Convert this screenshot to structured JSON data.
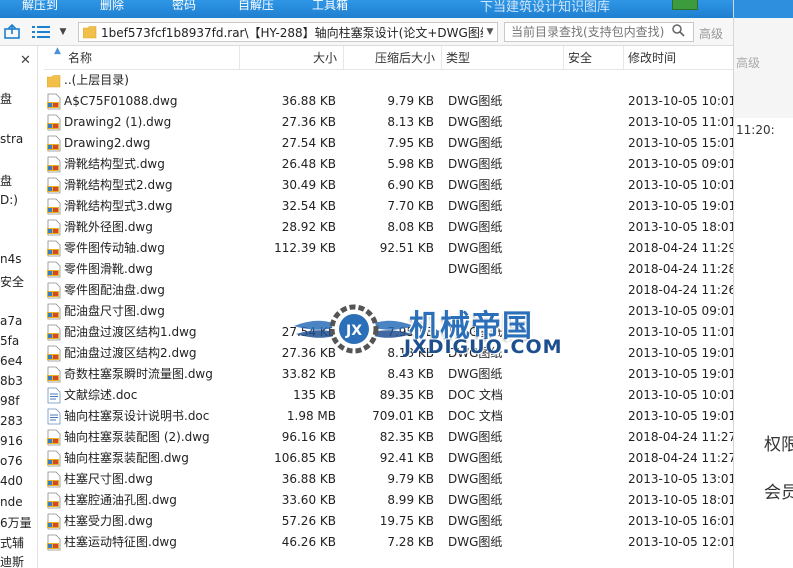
{
  "toolbar": {
    "extract_label": "解压到",
    "delete_label": "删除",
    "password_label": "密码",
    "selfextract_label": "自解压",
    "tools_label": "工具箱",
    "promo_text": "下当建筑设计知识图库"
  },
  "address": {
    "path": "1bef573fcf1b8937fd.rar\\【HY-288】轴向柱塞泵设计(论文+DWG图纸)",
    "search_placeholder": "当前目录查找(支持包内查找)",
    "advanced_label": "高级"
  },
  "left_pane": {
    "lines": [
      "盘",
      "stra",
      "盘",
      "D:)",
      "n4s",
      "安全",
      "a7a",
      "5fa",
      "6e4",
      "8b3",
      "98f",
      "283",
      "916",
      "o76",
      "4d0",
      "nde",
      "6万量",
      "式辅",
      "迪斯"
    ]
  },
  "columns": {
    "name": "名称",
    "size": "大小",
    "compressed": "压缩后大小",
    "type": "类型",
    "security": "安全",
    "modified": "修改时间"
  },
  "parent_row": {
    "name": "..(上层目录)"
  },
  "files": [
    {
      "name": "A$C75F01088.dwg",
      "size": "36.88 KB",
      "compressed": "9.79 KB",
      "type": "DWG图纸",
      "modified": "2013-10-05 10:01:",
      "icon": "dwg"
    },
    {
      "name": "Drawing2 (1).dwg",
      "size": "27.36 KB",
      "compressed": "8.13 KB",
      "type": "DWG图纸",
      "modified": "2013-10-05 11:01:",
      "icon": "dwg"
    },
    {
      "name": "Drawing2.dwg",
      "size": "27.54 KB",
      "compressed": "7.95 KB",
      "type": "DWG图纸",
      "modified": "2013-10-05 15:01:",
      "icon": "dwg"
    },
    {
      "name": "滑靴结构型式.dwg",
      "size": "26.48 KB",
      "compressed": "5.98 KB",
      "type": "DWG图纸",
      "modified": "2013-10-05 09:01:",
      "icon": "dwg"
    },
    {
      "name": "滑靴结构型式2.dwg",
      "size": "30.49 KB",
      "compressed": "6.90 KB",
      "type": "DWG图纸",
      "modified": "2013-10-05 10:01:",
      "icon": "dwg"
    },
    {
      "name": "滑靴结构型式3.dwg",
      "size": "32.54 KB",
      "compressed": "7.70 KB",
      "type": "DWG图纸",
      "modified": "2013-10-05 19:01:",
      "icon": "dwg"
    },
    {
      "name": "滑靴外径图.dwg",
      "size": "28.92 KB",
      "compressed": "8.08 KB",
      "type": "DWG图纸",
      "modified": "2013-10-05 18:01:",
      "icon": "dwg"
    },
    {
      "name": "零件图传动轴.dwg",
      "size": "112.39 KB",
      "compressed": "92.51 KB",
      "type": "DWG图纸",
      "modified": "2018-04-24 11:29:",
      "icon": "dwg"
    },
    {
      "name": "零件图滑靴.dwg",
      "size": "",
      "compressed": "",
      "type": "DWG图纸",
      "modified": "2018-04-24 11:28:",
      "icon": "dwg"
    },
    {
      "name": "零件图配油盘.dwg",
      "size": "",
      "compressed": "",
      "type": "",
      "modified": "2018-04-24 11:26:",
      "icon": "dwg"
    },
    {
      "name": "配油盘尺寸图.dwg",
      "size": "",
      "compressed": "",
      "type": "",
      "modified": "2013-10-05 09:01:",
      "icon": "dwg"
    },
    {
      "name": "配油盘过渡区结构1.dwg",
      "size": "27.54 KB",
      "compressed": "7.95 KB",
      "type": "DWG图纸",
      "modified": "2013-10-05 11:01:",
      "icon": "dwg"
    },
    {
      "name": "配油盘过渡区结构2.dwg",
      "size": "27.36 KB",
      "compressed": "8.13 KB",
      "type": "DWG图纸",
      "modified": "2013-10-05 19:01:",
      "icon": "dwg"
    },
    {
      "name": "奇数柱塞泵瞬时流量图.dwg",
      "size": "33.82 KB",
      "compressed": "8.43 KB",
      "type": "DWG图纸",
      "modified": "2013-10-05 19:01:",
      "icon": "dwg"
    },
    {
      "name": "文献综述.doc",
      "size": "135 KB",
      "compressed": "89.35 KB",
      "type": "DOC 文档",
      "modified": "2013-10-05 10:01:",
      "icon": "doc"
    },
    {
      "name": "轴向柱塞泵设计说明书.doc",
      "size": "1.98 MB",
      "compressed": "709.01 KB",
      "type": "DOC 文档",
      "modified": "2013-10-05 19:01:",
      "icon": "doc"
    },
    {
      "name": "轴向柱塞泵装配图 (2).dwg",
      "size": "96.16 KB",
      "compressed": "82.35 KB",
      "type": "DWG图纸",
      "modified": "2018-04-24 11:27:",
      "icon": "dwg"
    },
    {
      "name": "轴向柱塞泵装配图.dwg",
      "size": "106.85 KB",
      "compressed": "92.41 KB",
      "type": "DWG图纸",
      "modified": "2018-04-24 11:27:",
      "icon": "dwg"
    },
    {
      "name": "柱塞尺寸图.dwg",
      "size": "36.88 KB",
      "compressed": "9.79 KB",
      "type": "DWG图纸",
      "modified": "2013-10-05 13:01:",
      "icon": "dwg"
    },
    {
      "name": "柱塞腔通油孔图.dwg",
      "size": "33.60 KB",
      "compressed": "8.99 KB",
      "type": "DWG图纸",
      "modified": "2013-10-05 18:01:",
      "icon": "dwg"
    },
    {
      "name": "柱塞受力图.dwg",
      "size": "57.26 KB",
      "compressed": "19.75 KB",
      "type": "DWG图纸",
      "modified": "2013-10-05 16:01:",
      "icon": "dwg"
    },
    {
      "name": "柱塞运动特征图.dwg",
      "size": "46.26 KB",
      "compressed": "7.28 KB",
      "type": "DWG图纸",
      "modified": "2013-10-05 12:01:",
      "icon": "dwg"
    }
  ],
  "watermark": {
    "cn": "机械帝国",
    "en": "JXDIGUO.COM",
    "logo_text": "JX"
  },
  "background_window": {
    "advanced": "高级",
    "time": "11:20:",
    "text1": "权限",
    "text2": "会员"
  },
  "colors": {
    "toolbar_blue": "#1f7fd0",
    "folder_yellow": "#f2c04a",
    "watermark_blue": "#2b6fb8"
  }
}
